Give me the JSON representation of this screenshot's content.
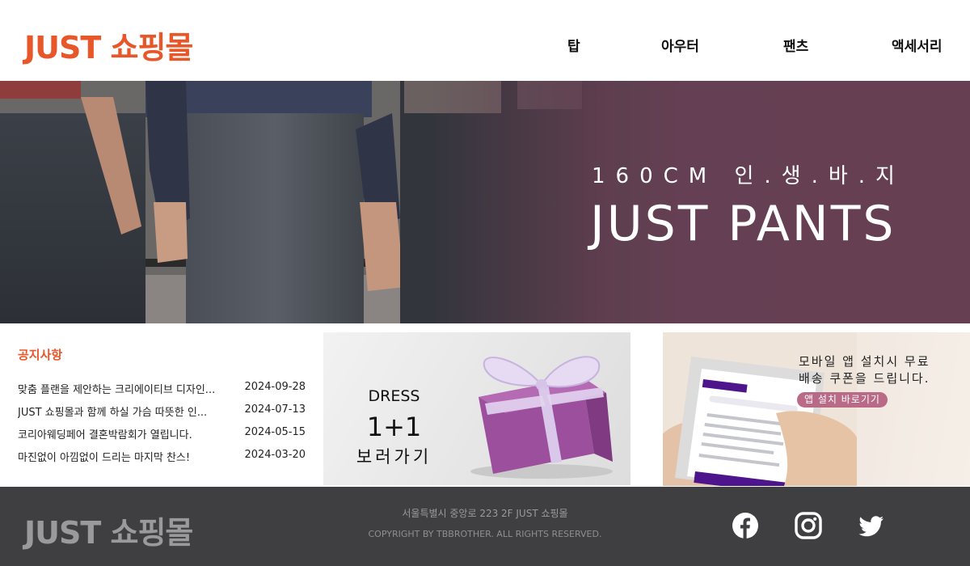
{
  "header": {
    "logo": "JUST 쇼핑몰",
    "nav": [
      "탑",
      "아우터",
      "팬츠",
      "액세서리"
    ]
  },
  "hero": {
    "subtitle": "160CM 인.생.바.지",
    "title": "JUST PANTS"
  },
  "notice": {
    "title": "공지사항",
    "items": [
      {
        "text": "맞춤 플랜을 제안하는 크리에이티브 디자인...",
        "date": "2024-09-28"
      },
      {
        "text": "JUST 쇼핑몰과 함께 하실 가슴 따뜻한 인...",
        "date": "2024-07-13"
      },
      {
        "text": "코리아웨딩페어 결혼박람회가 열립니다.",
        "date": "2024-05-15"
      },
      {
        "text": "마진없이 아낌없이 드리는 마지막 찬스!",
        "date": "2024-03-20"
      }
    ]
  },
  "dress_banner": {
    "line1": "DRESS",
    "line2": "1+1",
    "line3": "보러가기"
  },
  "app_banner": {
    "line1": "모바일 앱 설치시 무료",
    "line2": "배송 쿠폰을 드립니다.",
    "button": "앱 설치 바로기기"
  },
  "footer": {
    "logo": "JUST 쇼핑몰",
    "address": "서울특별시 중앙로 223 2F JUST 쇼핑몰",
    "copyright": "COPYRIGHT BY TBBROTHER. ALL RIGHTS RESERVED.",
    "sns": [
      "facebook-icon",
      "instagram-icon",
      "twitter-icon"
    ]
  },
  "colors": {
    "accent": "#e8572a",
    "hero_purple": "#663f52",
    "footer_bg": "#3f3e40",
    "app_button": "#b96a86"
  }
}
